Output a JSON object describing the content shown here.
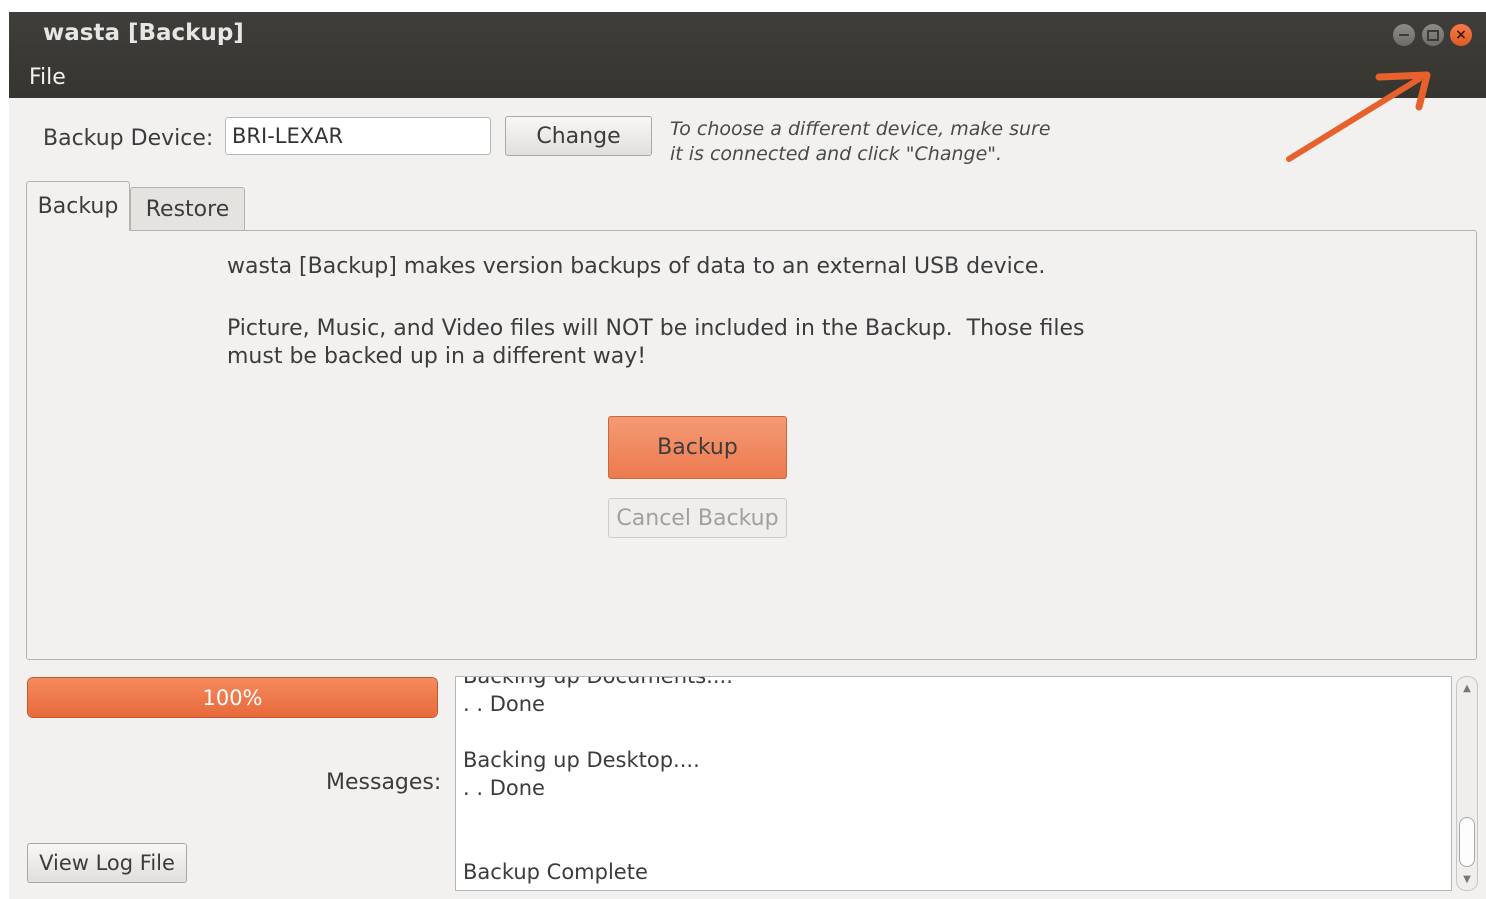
{
  "window": {
    "title": "wasta [Backup]",
    "menu": {
      "file": "File"
    },
    "controls": {
      "minimize": "minimize-icon",
      "maximize": "maximize-icon",
      "close": "close-icon"
    }
  },
  "device": {
    "label": "Backup Device:",
    "value": "BRI-LEXAR",
    "change_button": "Change",
    "hint_line1": "To choose a different device, make sure",
    "hint_line2": "it is connected and click \"Change\"."
  },
  "tabs": [
    {
      "label": "Backup",
      "active": true
    },
    {
      "label": "Restore",
      "active": false
    }
  ],
  "backup_panel": {
    "intro": "wasta [Backup] makes version backups of data to an external USB device.",
    "warning_line1": "Picture, Music, and Video files will NOT be included in the Backup.  Those files",
    "warning_line2": "must be backed up in a different way!",
    "backup_button": "Backup",
    "cancel_button": "Cancel Backup"
  },
  "progress": {
    "label": "100%",
    "value": 1.0
  },
  "messages": {
    "label": "Messages:",
    "lines": [
      "Backing up Documents....",
      ". . Done",
      "",
      "Backing up Desktop....",
      ". . Done",
      "",
      "",
      "Backup Complete"
    ]
  },
  "view_log_button": "View Log File",
  "colors": {
    "accent": "#ec7a4f",
    "titlebar": "#3c3b37",
    "annotation_arrow": "#e8612c"
  }
}
